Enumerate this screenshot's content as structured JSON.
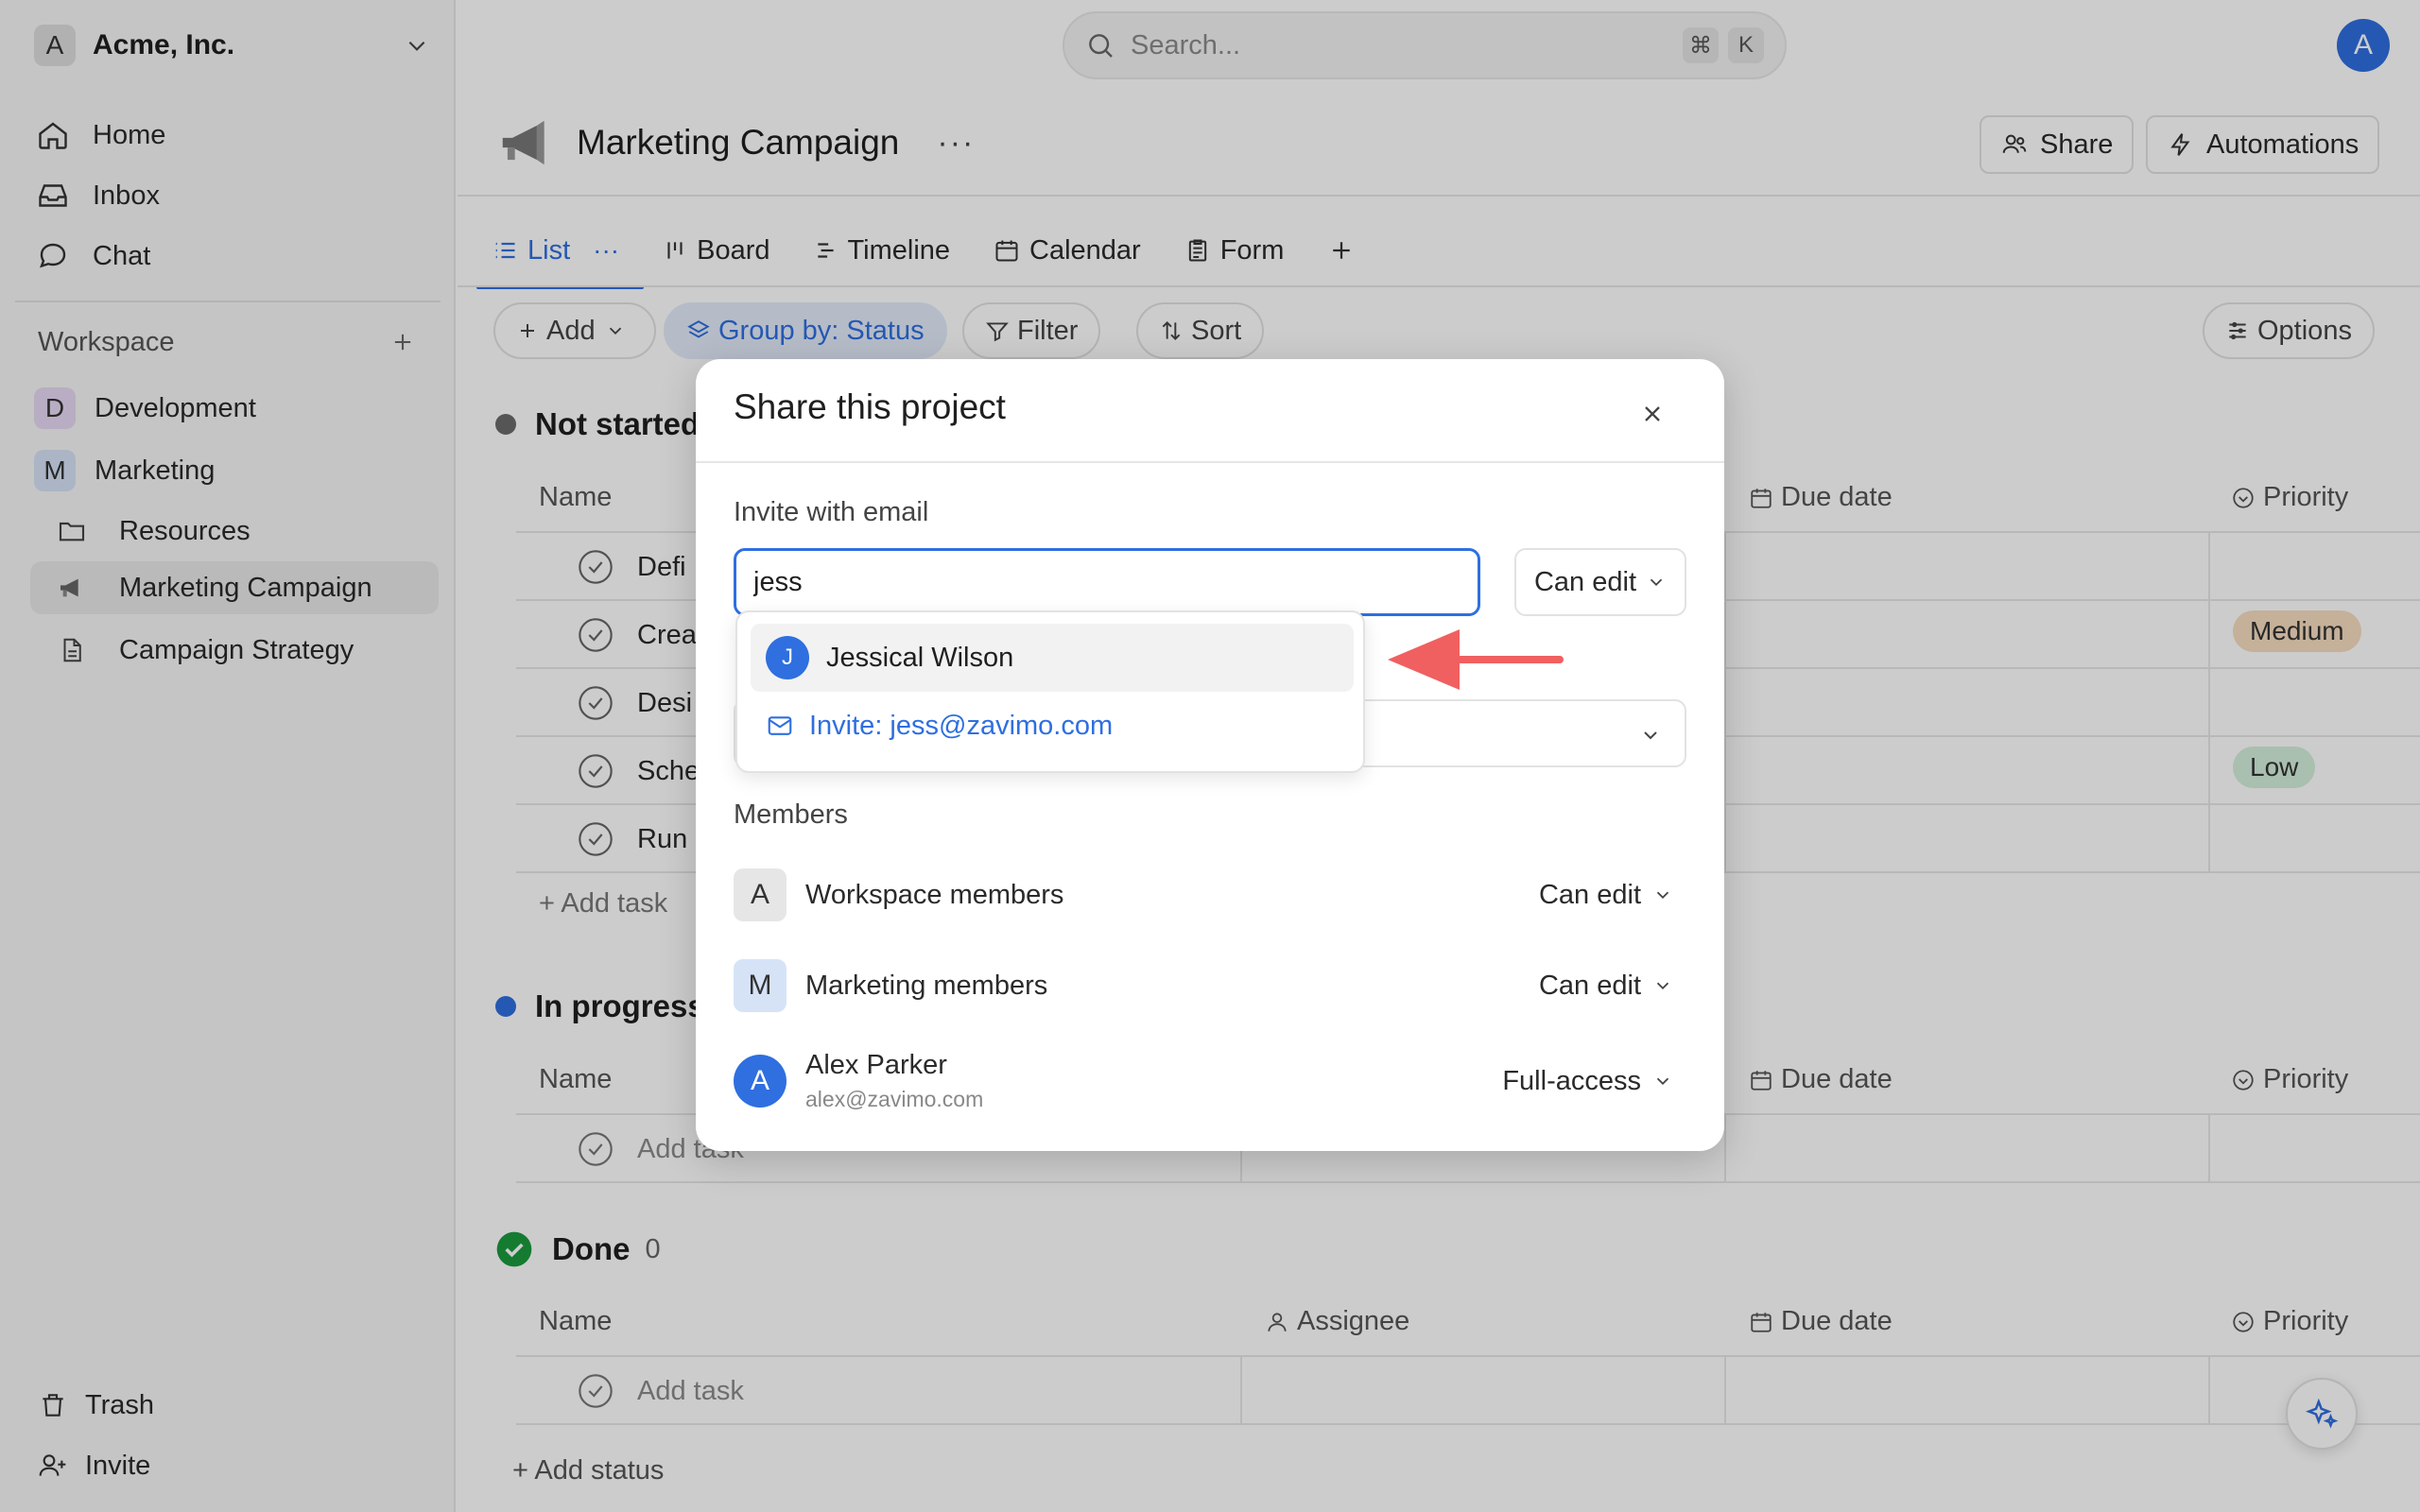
{
  "workspace": {
    "avatar_letter": "A",
    "name": "Acme, Inc."
  },
  "search": {
    "placeholder": "Search...",
    "shortcut_mod": "⌘",
    "shortcut_key": "K"
  },
  "user": {
    "avatar_letter": "A"
  },
  "sidebar": {
    "nav": [
      {
        "label": "Home",
        "icon": "home-icon"
      },
      {
        "label": "Inbox",
        "icon": "inbox-icon"
      },
      {
        "label": "Chat",
        "icon": "chat-icon"
      }
    ],
    "section_title": "Workspace",
    "teams": [
      {
        "letter": "D",
        "label": "Development",
        "color": "#e7d9f3"
      },
      {
        "letter": "M",
        "label": "Marketing",
        "color": "#d6e3f7"
      }
    ],
    "items": [
      {
        "label": "Resources",
        "icon": "folder-icon"
      },
      {
        "label": "Marketing Campaign",
        "icon": "megaphone-icon"
      },
      {
        "label": "Campaign Strategy",
        "icon": "document-icon"
      }
    ],
    "bottom": [
      {
        "label": "Trash",
        "icon": "trash-icon"
      },
      {
        "label": "Invite",
        "icon": "add-user-icon"
      }
    ]
  },
  "project": {
    "title": "Marketing Campaign",
    "more": "···",
    "share_label": "Share",
    "automations_label": "Automations"
  },
  "tabs": [
    {
      "label": "List",
      "active": true
    },
    {
      "label": "Board"
    },
    {
      "label": "Timeline"
    },
    {
      "label": "Calendar"
    },
    {
      "label": "Form"
    }
  ],
  "toolbar": {
    "add_label": "Add",
    "group_label": "Group by: Status",
    "filter_label": "Filter",
    "sort_label": "Sort",
    "options_label": "Options"
  },
  "columns": {
    "name": "Name",
    "assignee": "Assignee",
    "due": "Due date",
    "priority": "Priority"
  },
  "groups": [
    {
      "title": "Not started",
      "color": "#6b6b6b",
      "tasks": [
        "Defi",
        "Crea",
        "Desi",
        "Sche",
        "Run p"
      ],
      "add_task": "+ Add task"
    },
    {
      "title": "In progress",
      "color": "#2f6fe0",
      "add_task_placeholder": "Add task"
    },
    {
      "title": "Done",
      "count": "0",
      "color": "#1a9a3e",
      "add_task_placeholder": "Add task"
    }
  ],
  "priorities": {
    "medium": "Medium",
    "low": "Low"
  },
  "add_status": "+ Add status",
  "modal": {
    "title": "Share this project",
    "invite_label": "Invite with email",
    "email_value": "jess",
    "permission": "Can edit",
    "members_label": "Members",
    "members": [
      {
        "letter": "A",
        "name": "Workspace members",
        "permission": "Can edit",
        "bg": "#e6e6e6"
      },
      {
        "letter": "M",
        "name": "Marketing members",
        "permission": "Can edit",
        "bg": "#d6e3f7"
      },
      {
        "letter": "A",
        "name": "Alex Parker",
        "email": "alex@zavimo.com",
        "permission": "Full-access"
      }
    ]
  },
  "autocomplete": {
    "suggestion": {
      "letter": "J",
      "name": "Jessical Wilson"
    },
    "invite_text": "Invite: jess@zavimo.com"
  },
  "colors": {
    "accent": "#2f6fe0",
    "arrow": "#f06060",
    "medium_badge": "#f7dcc0",
    "low_badge": "#d4efdb"
  }
}
